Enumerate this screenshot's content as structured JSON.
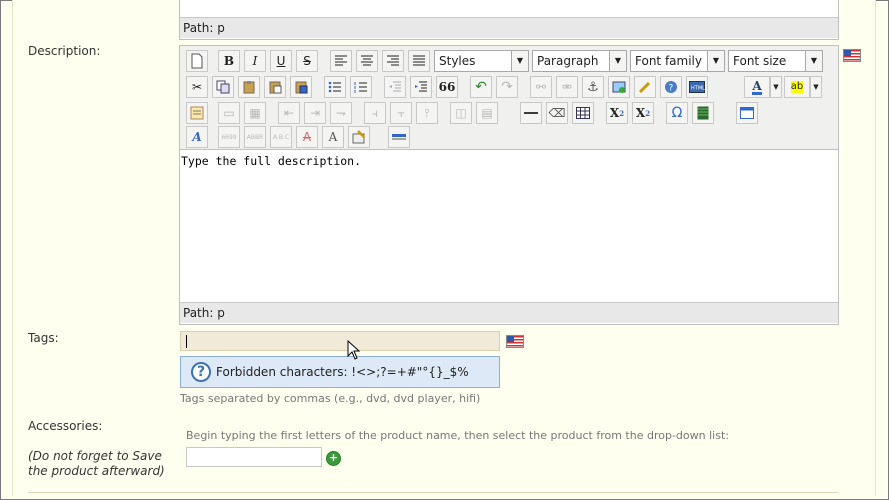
{
  "top_editor": {
    "path": "Path: p"
  },
  "description": {
    "label": "Description:",
    "toolbar": {
      "styles": "Styles",
      "format": "Paragraph",
      "font_family": "Font family",
      "font_size": "Font size",
      "bold": "B",
      "italic": "I",
      "underline": "U",
      "strike": "S",
      "blockquote": "66",
      "subscript": "X",
      "superscript": "X",
      "omega": "Ω"
    },
    "content": "Type the full description.",
    "path": "Path: p"
  },
  "tags": {
    "label": "Tags:",
    "hint": "Forbidden characters: !<>;?=+#\"°{}_$%",
    "help": "Tags separated by commas (e.g., dvd, dvd player, hifi)"
  },
  "accessories": {
    "label": "Accessories:",
    "note": "(Do not forget to Save the product afterward)",
    "instructions": "Begin typing the first letters of the product name, then select the product from the drop-down list:",
    "input_value": ""
  },
  "colors": {
    "background": "#fffff0",
    "hint_bg": "#dde9f6",
    "tags_bg": "#f1ead8"
  }
}
